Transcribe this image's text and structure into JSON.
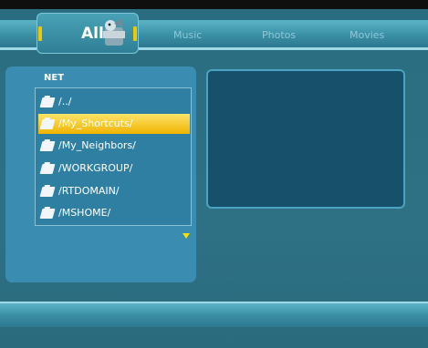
{
  "tabs": {
    "active": "All",
    "others": [
      "Music",
      "Photos",
      "Movies"
    ]
  },
  "browser": {
    "section_title": "NET",
    "items": [
      {
        "label": "/../",
        "icon": "folder-icon"
      },
      {
        "label": "/My_Shortcuts/",
        "icon": "folder-icon"
      },
      {
        "label": "/My_Neighbors/",
        "icon": "folder-icon"
      },
      {
        "label": "/WORKGROUP/",
        "icon": "folder-icon"
      },
      {
        "label": "/RTDOMAIN/",
        "icon": "folder-icon"
      },
      {
        "label": "/MSHOME/",
        "icon": "folder-icon"
      }
    ],
    "selected_index": 1
  },
  "colors": {
    "accent": "#f0b300",
    "background": "#2f6f83",
    "panel": "#3a8cb0",
    "preview": "#16506a"
  }
}
